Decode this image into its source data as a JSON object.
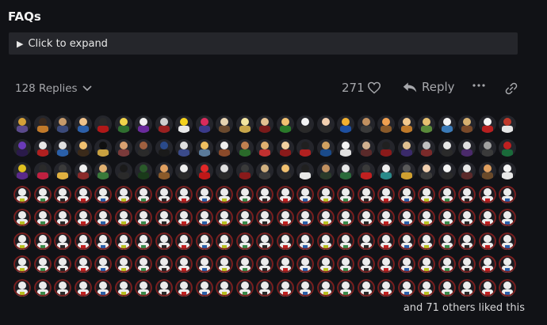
{
  "faq": {
    "title": "FAQs",
    "expand_label": "Click to expand"
  },
  "post_actions": {
    "replies_label": "128 Replies",
    "like_count": "271",
    "reply_label": "Reply"
  },
  "likes": {
    "summary": "and 71 others liked this",
    "avatar_total": 200,
    "custom_avatars": [
      [
        "#5b4a8c",
        "#d4a037"
      ],
      [
        "#c27a2a",
        "#3a2a1e"
      ],
      [
        "#3b4a7a",
        "#c79b6b"
      ],
      [
        "#2c5fa8",
        "#f0c28a"
      ],
      [
        "#b01818",
        "#2a2a2a"
      ],
      [
        "#2f6f2f",
        "#f1d34a"
      ],
      [
        "#6a2a9c",
        "#f2f2f2"
      ],
      [
        "#9a2020",
        "#cfcfcf"
      ],
      [
        "#e8e8e8",
        "#f4d21c"
      ],
      [
        "#3a3a8a",
        "#d92b5c"
      ],
      [
        "#6b4a2e",
        "#e6d3b0"
      ],
      [
        "#c8a64a",
        "#f2e5a0"
      ],
      [
        "#7a1a1a",
        "#e3c090"
      ],
      [
        "#2a7a2a",
        "#f0c070"
      ],
      [
        "#2a2a2a",
        "#f5f5f5"
      ],
      [
        "#2a2a2a",
        "#f2d0b0"
      ],
      [
        "#1d4fa0",
        "#f0b030"
      ],
      [
        "#3a3a3a",
        "#c09060"
      ],
      [
        "#8a5a2a",
        "#f0a050"
      ],
      [
        "#c07a2a",
        "#f3c98d"
      ],
      [
        "#5a8a3a",
        "#e6c070"
      ],
      [
        "#3a7ab8",
        "#f5f5f5"
      ],
      [
        "#7a4a2a",
        "#d6b070"
      ],
      [
        "#b82020",
        "#f5f5f5"
      ],
      [
        "#e6e6e6",
        "#c0392b"
      ],
      [
        "#2a1a4a",
        "#6a3ab8"
      ],
      [
        "#b02020",
        "#e8e8e8"
      ],
      [
        "#2a5fa8",
        "#e0e0e0"
      ],
      [
        "#3a2a1a",
        "#f0c070"
      ],
      [
        "#c8a040",
        "#101010"
      ],
      [
        "#7a3a3a",
        "#d8a070"
      ],
      [
        "#2a2a2a",
        "#a06040"
      ],
      [
        "#1a1a1a",
        "#2a4a8a"
      ],
      [
        "#3a4a8a",
        "#e0e0e0"
      ],
      [
        "#5a7a9a",
        "#f0c060"
      ],
      [
        "#8a4a2a",
        "#f0f0f0"
      ],
      [
        "#2a6a2a",
        "#c08050"
      ],
      [
        "#c03030",
        "#e0b070"
      ],
      [
        "#8a1a1a",
        "#f2d0a0"
      ],
      [
        "#b02020",
        "#202020"
      ],
      [
        "#1a4a8a",
        "#d0a060"
      ],
      [
        "#e0e0e0",
        "#f5f5f5"
      ],
      [
        "#5a2a2a",
        "#d0b090"
      ],
      [
        "#8a1a1a",
        "#202020"
      ],
      [
        "#3a2a6a",
        "#e0c090"
      ],
      [
        "#7a2a2a",
        "#c0c0c0"
      ],
      [
        "#2a2a2a",
        "#e8e8e8"
      ],
      [
        "#4a2a6a",
        "#e0e0e0"
      ],
      [
        "#3a3a3a",
        "#a0a0a0"
      ],
      [
        "#1a6a3a",
        "#c02020"
      ],
      [
        "#5a2a8a",
        "#e0c020"
      ],
      [
        "#c02040",
        "#2a2a2a"
      ],
      [
        "#e0b040",
        "#3a3a3a"
      ],
      [
        "#8a2a2a",
        "#f0f0f0"
      ],
      [
        "#3a7a3a",
        "#e0b070"
      ],
      [
        "#2a2a2a",
        "#1a1a1a"
      ],
      [
        "#1a3a1a",
        "#2a5a2a"
      ],
      [
        "#8a5a2a",
        "#e0a060"
      ],
      [
        "#2a2a2a",
        "#f0f0f0"
      ],
      [
        "#c01818",
        "#e02828"
      ],
      [
        "#2a2a2a",
        "#e0e0e0"
      ],
      [
        "#8a1a1a",
        "#3a3a3a"
      ],
      [
        "#3a3a3a",
        "#d0b080"
      ],
      [
        "#2a2a2a",
        "#f0c070"
      ],
      [
        "#e8e8e8",
        "#202020"
      ],
      [
        "#2a3a2a",
        "#c09060"
      ],
      [
        "#2a6a3a",
        "#e8e8e8"
      ],
      [
        "#c02020",
        "#3a3a3a"
      ],
      [
        "#2a8a8a",
        "#f0f0f0"
      ],
      [
        "#d0a030",
        "#5a5a5a"
      ],
      [
        "#3a3a3a",
        "#f0d0b0"
      ],
      [
        "#2a2a2a",
        "#f5f5f5"
      ],
      [
        "#5a2a2a",
        "#e8e8e8"
      ],
      [
        "#6a4a2a",
        "#e0a060"
      ],
      [
        "#e8e8e8",
        "#f5f5f5"
      ]
    ]
  },
  "colors": {
    "background": "#111216",
    "expander": "#25262b",
    "muted": "#a6a7ab"
  }
}
